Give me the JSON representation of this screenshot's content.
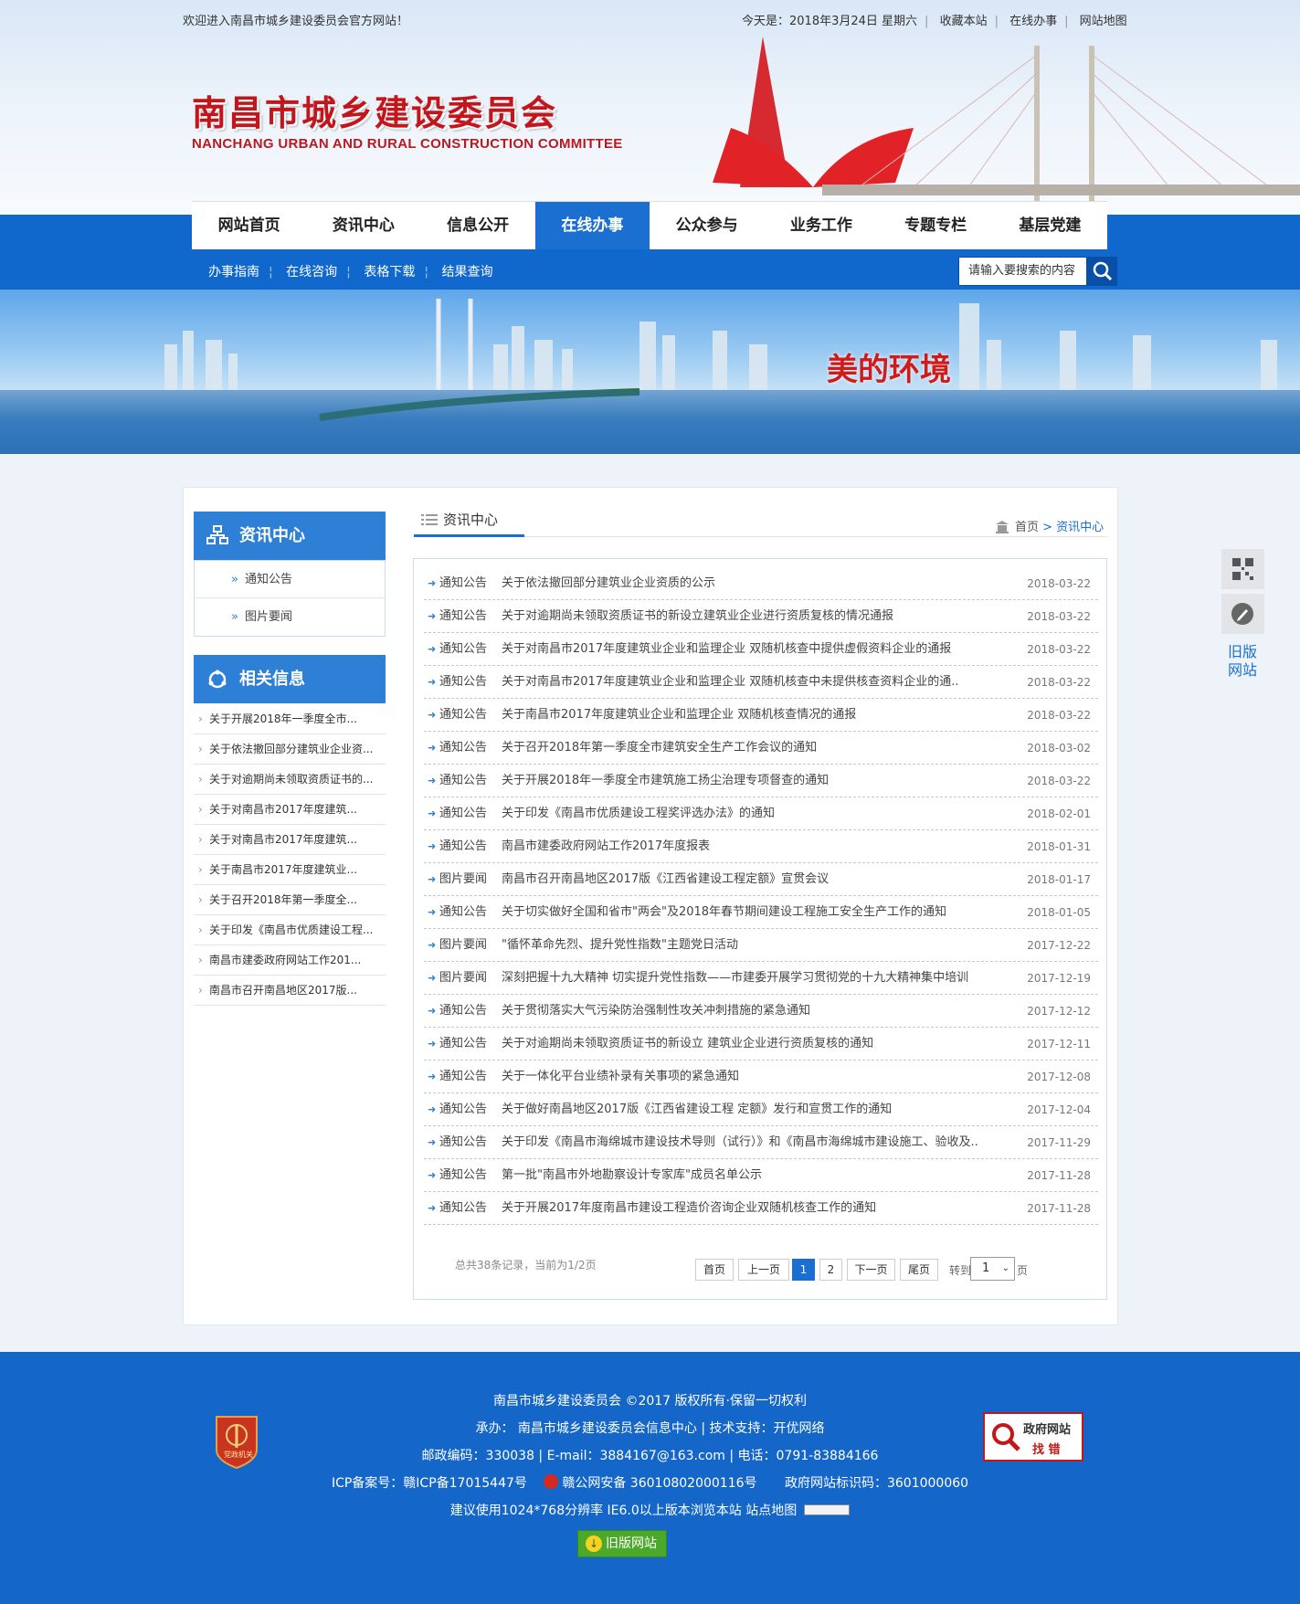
{
  "top": {
    "welcome": "欢迎进入南昌市城乡建设委员会官方网站！",
    "today": "今天是：2018年3月24日 星期六",
    "links": [
      "收藏本站",
      "在线办事",
      "网站地图"
    ]
  },
  "logo": {
    "cn": "南昌市城乡建设委员会",
    "en": "NANCHANG URBAN AND RURAL CONSTRUCTION COMMITTEE"
  },
  "nav": [
    "网站首页",
    "资讯中心",
    "信息公开",
    "在线办事",
    "公众参与",
    "业务工作",
    "专题专栏",
    "基层党建"
  ],
  "subnav": [
    "办事指南",
    "在线咨询",
    "表格下载",
    "结果查询"
  ],
  "search": {
    "placeholder": "请输入要搜索的内容"
  },
  "banner": {
    "text": "美的环境"
  },
  "sidebar": {
    "title": "资讯中心",
    "items": [
      "通知公告",
      "图片要闻"
    ],
    "related_title": "相关信息",
    "related": [
      "关于开展2018年一季度全市...",
      "关于依法撤回部分建筑业企业资...",
      "关于对逾期尚未领取资质证书的...",
      "关于对南昌市2017年度建筑...",
      "关于对南昌市2017年度建筑...",
      "关于南昌市2017年度建筑业...",
      "关于召开2018年第一季度全...",
      "关于印发《南昌市优质建设工程...",
      "南昌市建委政府网站工作201...",
      "南昌市召开南昌地区2017版..."
    ]
  },
  "main": {
    "title": "资讯中心",
    "crumb_home": "首页",
    "crumb_current": "> 资讯中心",
    "rows": [
      {
        "cat": "通知公告",
        "title": "关于依法撤回部分建筑业企业资质的公示",
        "date": "2018-03-22"
      },
      {
        "cat": "通知公告",
        "title": "关于对逾期尚未领取资质证书的新设立建筑业企业进行资质复核的情况通报",
        "date": "2018-03-22"
      },
      {
        "cat": "通知公告",
        "title": "关于对南昌市2017年度建筑业企业和监理企业 双随机核查中提供虚假资料企业的通报",
        "date": "2018-03-22"
      },
      {
        "cat": "通知公告",
        "title": "关于对南昌市2017年度建筑业企业和监理企业 双随机核查中未提供核查资料企业的通..",
        "date": "2018-03-22"
      },
      {
        "cat": "通知公告",
        "title": "关于南昌市2017年度建筑业企业和监理企业 双随机核查情况的通报",
        "date": "2018-03-22"
      },
      {
        "cat": "通知公告",
        "title": "关于召开2018年第一季度全市建筑安全生产工作会议的通知",
        "date": "2018-03-02"
      },
      {
        "cat": "通知公告",
        "title": "关于开展2018年一季度全市建筑施工扬尘治理专项督查的通知",
        "date": "2018-03-22"
      },
      {
        "cat": "通知公告",
        "title": "关于印发《南昌市优质建设工程奖评选办法》的通知",
        "date": "2018-02-01"
      },
      {
        "cat": "通知公告",
        "title": "南昌市建委政府网站工作2017年度报表",
        "date": "2018-01-31"
      },
      {
        "cat": "图片要闻",
        "title": "南昌市召开南昌地区2017版《江西省建设工程定额》宣贯会议",
        "date": "2018-01-17"
      },
      {
        "cat": "通知公告",
        "title": "关于切实做好全国和省市\"两会\"及2018年春节期间建设工程施工安全生产工作的通知",
        "date": "2018-01-05"
      },
      {
        "cat": "图片要闻",
        "title": "\"循怀革命先烈、提升党性指数\"主题党日活动",
        "date": "2017-12-22"
      },
      {
        "cat": "图片要闻",
        "title": "深刻把握十九大精神 切实提升党性指数——市建委开展学习贯彻党的十九大精神集中培训",
        "date": "2017-12-19"
      },
      {
        "cat": "通知公告",
        "title": "关于贯彻落实大气污染防治强制性攻关冲刺措施的紧急通知",
        "date": "2017-12-12"
      },
      {
        "cat": "通知公告",
        "title": "关于对逾期尚未领取资质证书的新设立 建筑业企业进行资质复核的通知",
        "date": "2017-12-11"
      },
      {
        "cat": "通知公告",
        "title": "关于一体化平台业绩补录有关事项的紧急通知",
        "date": "2017-12-08"
      },
      {
        "cat": "通知公告",
        "title": "关于做好南昌地区2017版《江西省建设工程 定额》发行和宣贯工作的通知",
        "date": "2017-12-04"
      },
      {
        "cat": "通知公告",
        "title": "关于印发《南昌市海绵城市建设技术导则（试行）》和《南昌市海绵城市建设施工、验收及..",
        "date": "2017-11-29"
      },
      {
        "cat": "通知公告",
        "title": "第一批\"南昌市外地勘察设计专家库\"成员名单公示",
        "date": "2017-11-28"
      },
      {
        "cat": "通知公告",
        "title": "关于开展2017年度南昌市建设工程造价咨询企业双随机核查工作的通知",
        "date": "2017-11-28"
      }
    ]
  },
  "pagination": {
    "total": "总共38条记录，当前为1/2页",
    "first": "首页",
    "prev": "上一页",
    "p1": "1",
    "p2": "2",
    "next": "下一页",
    "last": "尾页",
    "jump": "转到",
    "select": "1",
    "unit": "页"
  },
  "float": {
    "old": "旧版网站"
  },
  "footer": {
    "l1": "南昌市城乡建设委员会 ©2017 版权所有·保留一切权利",
    "l2": "承办：  南昌市城乡建设委员会信息中心   |   技术支持：开优网络",
    "l3": "邮政编码：330038    |   E-mail：3884167@163.com    |   电话：0791-83884166",
    "l4a": "ICP备案号：赣ICP备17015447号",
    "l4b": "赣公网安备 36010802000116号",
    "l4c": "政府网站标识码：3601000060",
    "l5": "建议使用1024*768分辨率 IE6.0以上版本浏览本站   站点地图",
    "badge": "党政机关",
    "gov1": "政府网站",
    "gov2": "找 错",
    "oldbtn": "旧版网站"
  }
}
